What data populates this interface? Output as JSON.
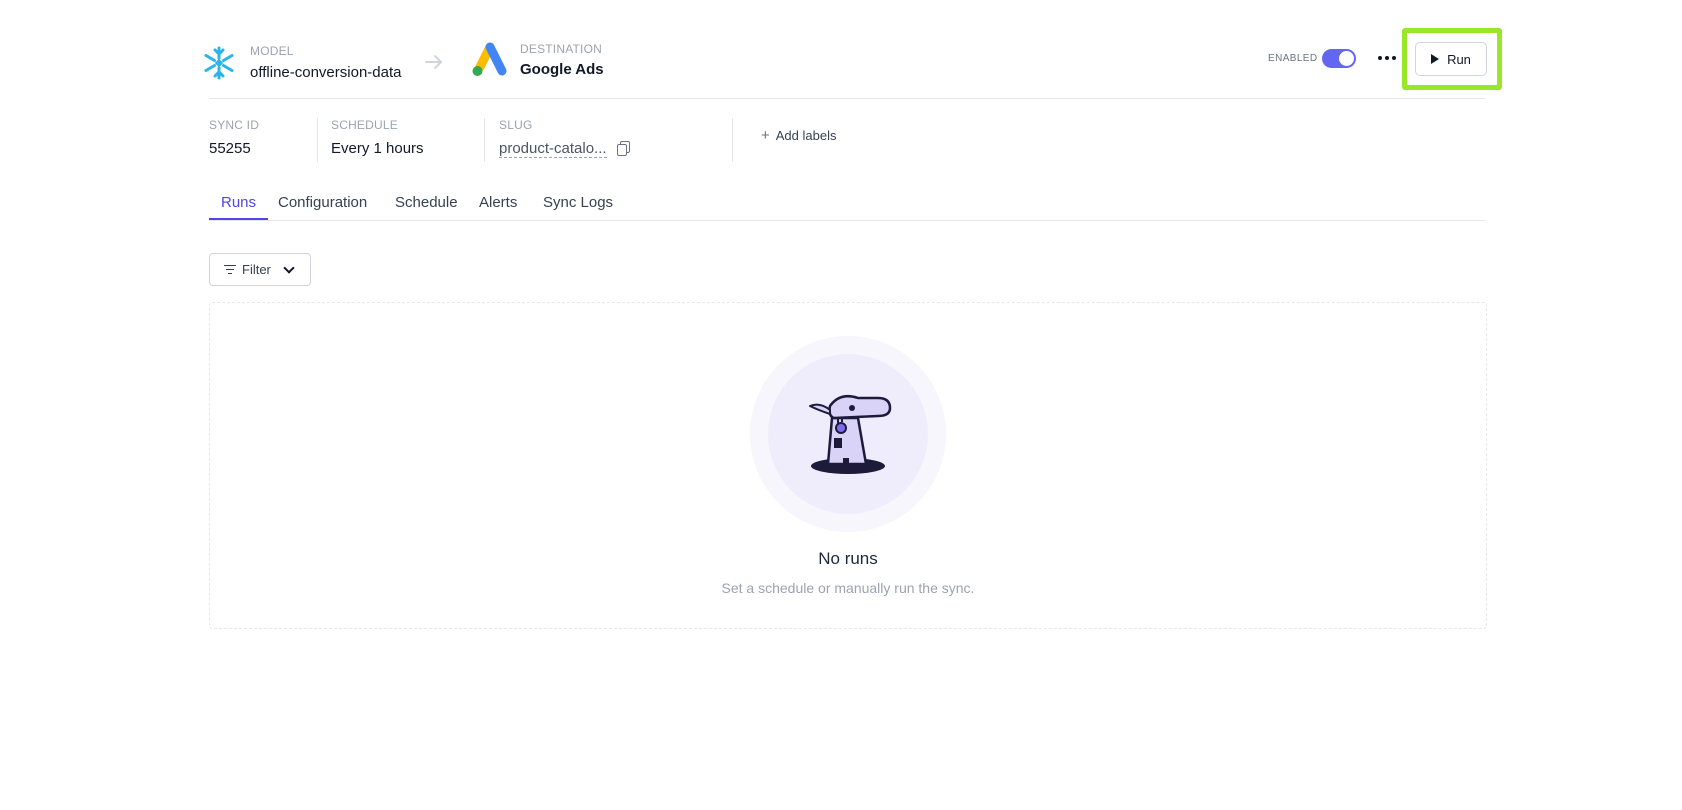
{
  "header": {
    "model_label": "MODEL",
    "model_name": "offline-conversion-data",
    "destination_label": "DESTINATION",
    "destination_name": "Google Ads",
    "enabled_label": "ENABLED",
    "enabled": true,
    "run_label": "Run"
  },
  "info": {
    "sync_id_label": "SYNC ID",
    "sync_id": "55255",
    "schedule_label": "SCHEDULE",
    "schedule": "Every 1 hours",
    "slug_label": "SLUG",
    "slug": "product-catalo...",
    "add_labels": "Add labels"
  },
  "tabs": [
    {
      "label": "Runs",
      "active": true
    },
    {
      "label": "Configuration",
      "active": false
    },
    {
      "label": "Schedule",
      "active": false
    },
    {
      "label": "Alerts",
      "active": false
    },
    {
      "label": "Sync Logs",
      "active": false
    }
  ],
  "filter_label": "Filter",
  "empty_state": {
    "title": "No runs",
    "subtitle": "Set a schedule or manually run the sync."
  },
  "colors": {
    "accent": "#6366f1",
    "highlight": "#9ae628",
    "snowflake": "#29b5e8"
  },
  "icons": [
    "snowflake-icon",
    "arrow-right-icon",
    "google-ads-icon",
    "more-icon",
    "play-icon",
    "copy-icon",
    "plus-icon",
    "filter-icon",
    "chevron-down-icon",
    "lighthouse-illustration"
  ]
}
